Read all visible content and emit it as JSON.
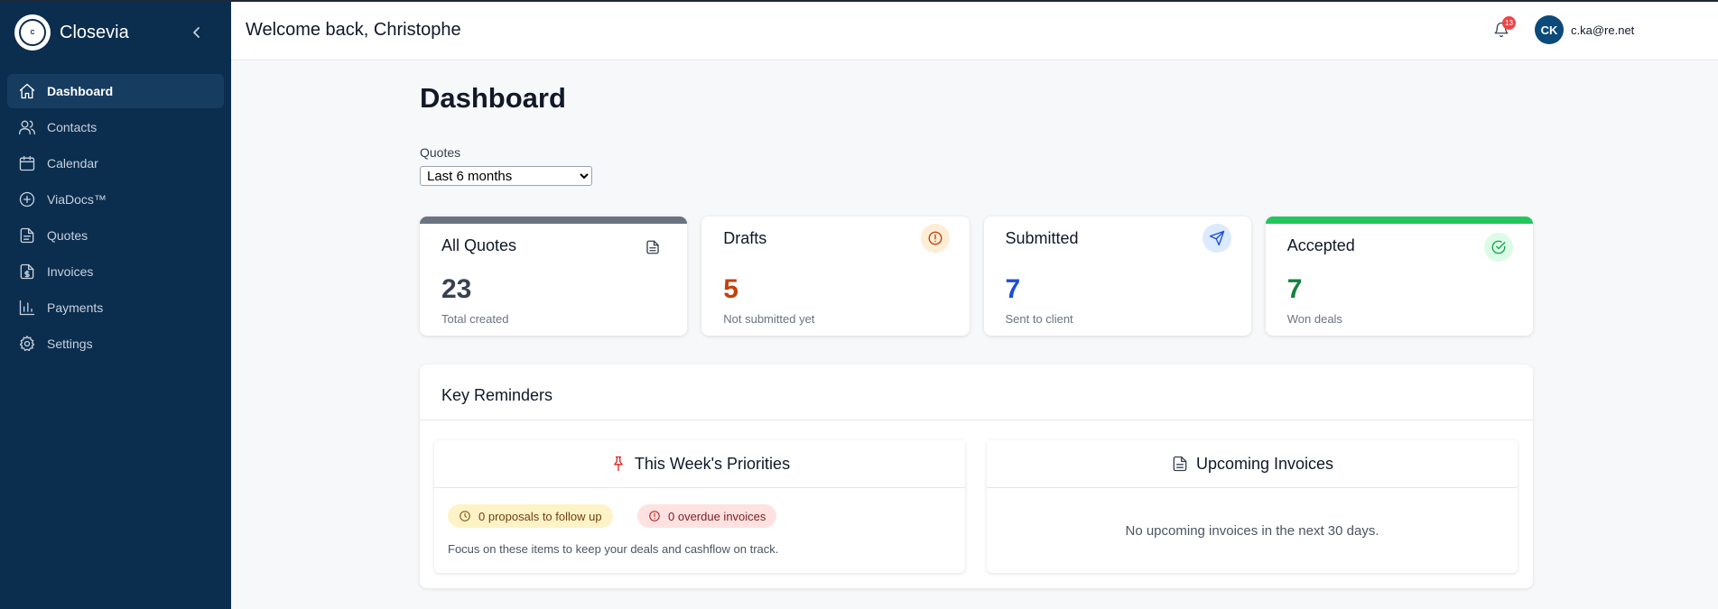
{
  "app": {
    "name": "Closevia",
    "logo_text": "Closevia"
  },
  "sidebar": {
    "items": [
      {
        "label": "Dashboard",
        "icon": "home-icon",
        "active": true
      },
      {
        "label": "Contacts",
        "icon": "users-icon"
      },
      {
        "label": "Calendar",
        "icon": "calendar-icon"
      },
      {
        "label": "ViaDocs™",
        "icon": "plus-circle-icon"
      },
      {
        "label": "Quotes",
        "icon": "file-icon"
      },
      {
        "label": "Invoices",
        "icon": "file-dollar-icon"
      },
      {
        "label": "Payments",
        "icon": "bar-chart-icon"
      },
      {
        "label": "Settings",
        "icon": "gear-icon"
      }
    ]
  },
  "topbar": {
    "welcome": "Welcome back, Christophe",
    "notification_count": "13",
    "avatar_initials": "CK",
    "email": "c.ka@re.net"
  },
  "main": {
    "title": "Dashboard",
    "filter_label": "Quotes",
    "filter_selected": "Last 6 months",
    "cards": [
      {
        "title": "All Quotes",
        "value": "23",
        "subtitle": "Total created",
        "icon": "document-icon",
        "color": "#374151",
        "icon_color": "#374151",
        "icon_bg": "#ffffff"
      },
      {
        "title": "Drafts",
        "value": "5",
        "subtitle": "Not submitted yet",
        "icon": "alert-circle-icon",
        "color": "#c2410c",
        "icon_color": "#c2410c",
        "icon_bg": "#ffedd5"
      },
      {
        "title": "Submitted",
        "value": "7",
        "subtitle": "Sent to client",
        "icon": "send-icon",
        "color": "#1d4ed8",
        "icon_color": "#1d4ed8",
        "icon_bg": "#dbeafe"
      },
      {
        "title": "Accepted",
        "value": "7",
        "subtitle": "Won deals",
        "icon": "check-circle-icon",
        "color": "#15803d",
        "icon_color": "#16a34a",
        "icon_bg": "#dcfce7"
      }
    ],
    "reminders": {
      "title": "Key Reminders",
      "priorities": {
        "title": "This Week's Priorities",
        "followups": "0 proposals to follow up",
        "overdue": "0 overdue invoices",
        "note": "Focus on these items to keep your deals and cashflow on track."
      },
      "upcoming": {
        "title": "Upcoming Invoices",
        "empty": "No upcoming invoices in the next 30 days."
      }
    }
  }
}
